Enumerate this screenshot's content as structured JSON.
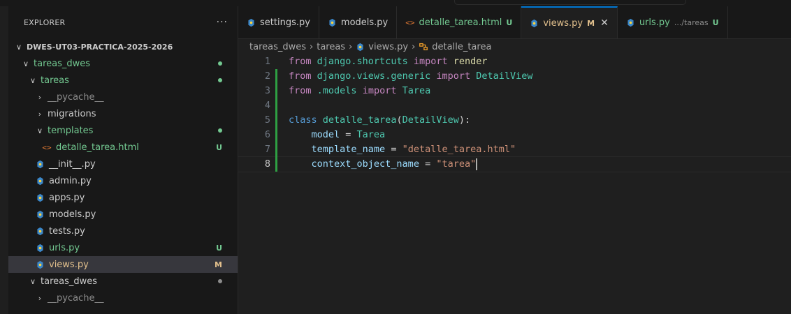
{
  "explorer": {
    "title": "EXPLORER",
    "more_label": "···",
    "items": [
      {
        "label": "DWES-UT03-PRACTICA-2025-2026",
        "type": "root",
        "depth": 0,
        "open": true,
        "color": "#cccccc",
        "status": "",
        "dot": ""
      },
      {
        "label": "tareas_dwes",
        "type": "folder",
        "depth": 1,
        "open": true,
        "color": "#73c991",
        "status": "",
        "dot": "#73c991"
      },
      {
        "label": "tareas",
        "type": "folder",
        "depth": 2,
        "open": true,
        "color": "#73c991",
        "status": "",
        "dot": "#73c991"
      },
      {
        "label": "__pycache__",
        "type": "folder",
        "depth": 3,
        "open": false,
        "color": "#8c8c8c",
        "status": "",
        "dot": ""
      },
      {
        "label": "migrations",
        "type": "folder",
        "depth": 3,
        "open": false,
        "color": "#cccccc",
        "status": "",
        "dot": ""
      },
      {
        "label": "templates",
        "type": "folder",
        "depth": 3,
        "open": true,
        "color": "#73c991",
        "status": "",
        "dot": "#73c991"
      },
      {
        "label": "detalle_tarea.html",
        "type": "html",
        "depth": 4,
        "open": false,
        "color": "#73c991",
        "status": "U",
        "dot": ""
      },
      {
        "label": "__init__.py",
        "type": "py",
        "depth": 3,
        "open": false,
        "color": "#cccccc",
        "status": "",
        "dot": ""
      },
      {
        "label": "admin.py",
        "type": "py",
        "depth": 3,
        "open": false,
        "color": "#cccccc",
        "status": "",
        "dot": ""
      },
      {
        "label": "apps.py",
        "type": "py",
        "depth": 3,
        "open": false,
        "color": "#cccccc",
        "status": "",
        "dot": ""
      },
      {
        "label": "models.py",
        "type": "py",
        "depth": 3,
        "open": false,
        "color": "#cccccc",
        "status": "",
        "dot": ""
      },
      {
        "label": "tests.py",
        "type": "py",
        "depth": 3,
        "open": false,
        "color": "#cccccc",
        "status": "",
        "dot": ""
      },
      {
        "label": "urls.py",
        "type": "py",
        "depth": 3,
        "open": false,
        "color": "#73c991",
        "status": "U",
        "dot": ""
      },
      {
        "label": "views.py",
        "type": "py",
        "depth": 3,
        "open": false,
        "color": "#e2c08d",
        "status": "M",
        "dot": "",
        "selected": true
      },
      {
        "label": "tareas_dwes",
        "type": "folder",
        "depth": 2,
        "open": true,
        "color": "#cccccc",
        "status": "",
        "dot": "#8c8c8c"
      },
      {
        "label": "__pycache__",
        "type": "folder",
        "depth": 3,
        "open": false,
        "color": "#8c8c8c",
        "status": "",
        "dot": ""
      }
    ]
  },
  "tabs": [
    {
      "label": "settings.py",
      "icon": "py",
      "status": "",
      "path": "",
      "active": false,
      "color": "#cccccc"
    },
    {
      "label": "models.py",
      "icon": "py",
      "status": "",
      "path": "",
      "active": false,
      "color": "#cccccc"
    },
    {
      "label": "detalle_tarea.html",
      "icon": "html",
      "status": "U",
      "path": "",
      "active": false,
      "color": "#73c991"
    },
    {
      "label": "views.py",
      "icon": "py",
      "status": "M",
      "path": "",
      "active": true,
      "color": "#e2c08d",
      "close": "✕"
    },
    {
      "label": "urls.py",
      "icon": "py",
      "status": "U",
      "path": ".../tareas",
      "active": false,
      "color": "#73c991"
    }
  ],
  "breadcrumb": [
    "tareas_dwes",
    "tareas",
    "views.py",
    "detalle_tarea"
  ],
  "code": {
    "current_line": 8,
    "lines": [
      {
        "n": "1",
        "mod": "",
        "tokens": [
          [
            "kw",
            "from"
          ],
          [
            "op",
            " "
          ],
          [
            "mod-n",
            "django.shortcuts"
          ],
          [
            "op",
            " "
          ],
          [
            "kw",
            "import"
          ],
          [
            "op",
            " "
          ],
          [
            "fn",
            "render"
          ]
        ]
      },
      {
        "n": "2",
        "mod": "#2ea043",
        "tokens": [
          [
            "kw",
            "from"
          ],
          [
            "op",
            " "
          ],
          [
            "mod-n",
            "django.views.generic"
          ],
          [
            "op",
            " "
          ],
          [
            "kw",
            "import"
          ],
          [
            "op",
            " "
          ],
          [
            "cls",
            "DetailView"
          ]
        ]
      },
      {
        "n": "3",
        "mod": "#2ea043",
        "tokens": [
          [
            "kw",
            "from"
          ],
          [
            "op",
            " "
          ],
          [
            "mod-n",
            ".models"
          ],
          [
            "op",
            " "
          ],
          [
            "kw",
            "import"
          ],
          [
            "op",
            " "
          ],
          [
            "cls",
            "Tarea"
          ]
        ]
      },
      {
        "n": "4",
        "mod": "#2ea043",
        "tokens": []
      },
      {
        "n": "5",
        "mod": "#2ea043",
        "tokens": [
          [
            "kw2",
            "class"
          ],
          [
            "op",
            " "
          ],
          [
            "cls",
            "detalle_tarea"
          ],
          [
            "op",
            "("
          ],
          [
            "cls",
            "DetailView"
          ],
          [
            "op",
            "):"
          ]
        ]
      },
      {
        "n": "6",
        "mod": "#2ea043",
        "tokens": [
          [
            "op",
            "    "
          ],
          [
            "var",
            "model"
          ],
          [
            "op",
            " = "
          ],
          [
            "cls",
            "Tarea"
          ]
        ]
      },
      {
        "n": "7",
        "mod": "#2ea043",
        "tokens": [
          [
            "op",
            "    "
          ],
          [
            "var",
            "template_name"
          ],
          [
            "op",
            " = "
          ],
          [
            "str",
            "\"detalle_tarea.html\""
          ]
        ]
      },
      {
        "n": "8",
        "mod": "#2ea043",
        "tokens": [
          [
            "op",
            "    "
          ],
          [
            "var",
            "context_object_name"
          ],
          [
            "op",
            " = "
          ],
          [
            "str",
            "\"tarea\""
          ]
        ]
      }
    ]
  },
  "colors": {
    "python_icon": "#3b87c9",
    "html_icon": "#e37933",
    "class_icon": "#ee9d28",
    "accent": "#0078d4"
  }
}
